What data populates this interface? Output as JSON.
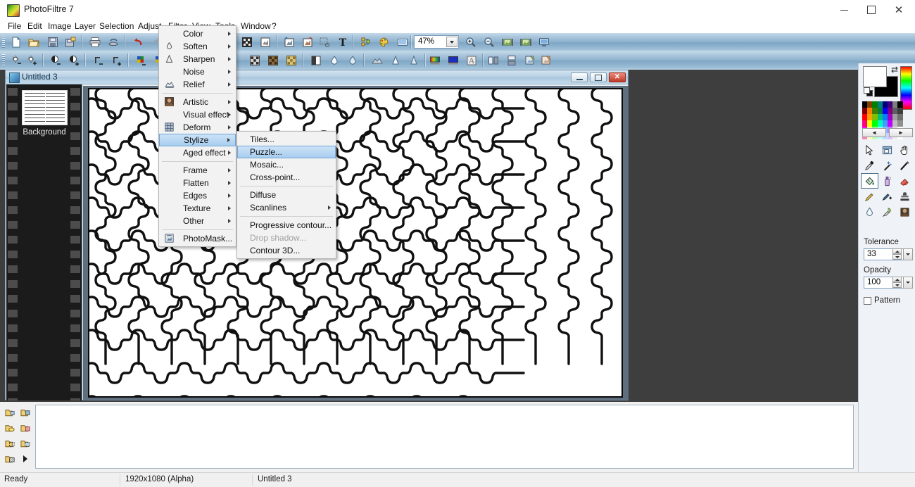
{
  "window": {
    "app_title": "PhotoFiltre 7",
    "app_icon": "photofiltre-logo-icon",
    "minimize": "minimize-icon",
    "maximize": "maximize-icon",
    "close": "close-icon"
  },
  "menubar": {
    "items": [
      {
        "label": "File",
        "accel": "F"
      },
      {
        "label": "Edit",
        "accel": "E"
      },
      {
        "label": "Image",
        "accel": "I"
      },
      {
        "label": "Layer",
        "accel": "L"
      },
      {
        "label": "Selection",
        "accel": "S"
      },
      {
        "label": "Adjust",
        "accel": "d"
      },
      {
        "label": "Filter",
        "accel": "t"
      },
      {
        "label": "View",
        "accel": "V"
      },
      {
        "label": "Tools",
        "accel": "T"
      },
      {
        "label": "Window",
        "accel": "W"
      },
      {
        "label": "?",
        "accel": ""
      }
    ],
    "active": "Filter"
  },
  "toolbar_main": {
    "zoom_value": "47%",
    "buttons": [
      "new-document-icon",
      "open-folder-icon",
      "save-icon",
      "save-as-icon",
      "print-icon",
      "print-preview-icon",
      "undo-icon",
      "redo-icon",
      "cut-icon",
      "copy-icon",
      "paste-icon",
      "image-size-icon",
      "canvas-size-icon",
      "rotate-left-icon",
      "rotate-right-icon",
      "crop-icon",
      "text-tool-icon",
      "layers-icon",
      "palette-icon",
      "slideshow-icon",
      "zoom-in-icon",
      "zoom-out-icon",
      "fit-image-icon",
      "actual-size-icon",
      "full-screen-icon"
    ]
  },
  "toolbar_filters": {
    "buttons": [
      "brightness-minus-icon",
      "brightness-plus-icon",
      "contrast-minus-icon",
      "contrast-plus-icon",
      "gamma-minus-icon",
      "gamma-plus-icon",
      "saturation-minus-icon",
      "saturation-plus-icon",
      "dither-icon",
      "halftone-icon",
      "sepia-icon",
      "grayscale-icon",
      "blur-icon",
      "soften-icon",
      "relief-icon",
      "sharpen-icon",
      "sharpen-more-icon",
      "gradient-icon",
      "color-fill-icon",
      "artistic-icon",
      "mirror-icon",
      "flip-icon",
      "photomask-icon",
      "photomask2-icon"
    ]
  },
  "filter_menu": {
    "items": [
      {
        "label": "Color",
        "submenu": true,
        "icon": null,
        "state": "normal"
      },
      {
        "label": "Soften",
        "submenu": true,
        "icon": "droplet-icon",
        "state": "normal"
      },
      {
        "label": "Sharpen",
        "submenu": true,
        "icon": "triangle-icon",
        "state": "normal"
      },
      {
        "label": "Noise",
        "submenu": true,
        "icon": null,
        "state": "normal"
      },
      {
        "label": "Relief",
        "submenu": true,
        "icon": "relief-icon",
        "state": "normal"
      },
      {
        "separator": true
      },
      {
        "label": "Artistic",
        "submenu": true,
        "icon": "portrait-icon",
        "state": "normal"
      },
      {
        "label": "Visual effect",
        "submenu": true,
        "icon": null,
        "state": "normal"
      },
      {
        "label": "Deform",
        "submenu": true,
        "icon": "grid-icon",
        "state": "normal"
      },
      {
        "label": "Stylize",
        "submenu": true,
        "icon": null,
        "state": "highlighted"
      },
      {
        "label": "Aged effect",
        "submenu": true,
        "icon": null,
        "state": "normal"
      },
      {
        "separator": true
      },
      {
        "label": "Frame",
        "submenu": true,
        "icon": null,
        "state": "normal"
      },
      {
        "label": "Flatten",
        "submenu": true,
        "icon": null,
        "state": "normal"
      },
      {
        "label": "Edges",
        "submenu": true,
        "icon": null,
        "state": "normal"
      },
      {
        "label": "Texture",
        "submenu": true,
        "icon": null,
        "state": "normal"
      },
      {
        "label": "Other",
        "submenu": true,
        "icon": null,
        "state": "normal"
      },
      {
        "separator": true
      },
      {
        "label": "PhotoMask...",
        "submenu": false,
        "icon": "photomask-icon",
        "state": "normal"
      }
    ]
  },
  "stylize_menu": {
    "items": [
      {
        "label": "Tiles...",
        "submenu": false,
        "state": "normal"
      },
      {
        "label": "Puzzle...",
        "submenu": false,
        "state": "highlighted"
      },
      {
        "label": "Mosaic...",
        "submenu": false,
        "state": "normal"
      },
      {
        "label": "Cross-point...",
        "submenu": false,
        "state": "normal"
      },
      {
        "separator": true
      },
      {
        "label": "Diffuse",
        "submenu": false,
        "state": "normal"
      },
      {
        "label": "Scanlines",
        "submenu": true,
        "state": "normal"
      },
      {
        "separator": true
      },
      {
        "label": "Progressive contour...",
        "submenu": false,
        "state": "normal"
      },
      {
        "label": "Drop shadow...",
        "submenu": false,
        "state": "disabled"
      },
      {
        "label": "Contour 3D...",
        "submenu": false,
        "state": "normal"
      }
    ]
  },
  "document": {
    "title": "Untitled 3",
    "layer_name": "Background",
    "min_btn": "minimize-icon",
    "max_btn": "restore-icon",
    "close_btn": "close-icon"
  },
  "right_panel": {
    "foreground_color": "#ffffff",
    "background_color": "#000000",
    "swap_icon": "swap-colors-icon",
    "reset_icon": "reset-colors-icon",
    "palette_prev": "◄",
    "palette_next": "►",
    "tools": [
      "pointer-select-icon",
      "rectangle-select-icon",
      "hand-pan-icon",
      "eyedropper-icon",
      "magic-wand-icon",
      "line-icon",
      "paint-bucket-icon",
      "spray-can-icon",
      "eraser-icon",
      "paintbrush-icon",
      "brush-plus-icon",
      "stamp-icon",
      "blur-drop-icon",
      "smudge-icon",
      "clone-portrait-icon"
    ],
    "selected_tool": "paint-bucket-icon",
    "tolerance_label": "Tolerance",
    "tolerance_value": "33",
    "opacity_label": "Opacity",
    "opacity_value": "100",
    "pattern_label": "Pattern",
    "pattern_checked": false
  },
  "bottom_tools": {
    "buttons": [
      "new-layer-icon",
      "duplicate-layer-icon",
      "open-layer-icon",
      "save-layer-icon",
      "layer-from-selection-icon",
      "selection-from-layer-icon",
      "transparency-layer-icon",
      "expand-arrow-icon"
    ]
  },
  "statusbar": {
    "status": "Ready",
    "dimensions": "1920x1080 (Alpha)",
    "document": "Untitled 3"
  },
  "palette_colors": [
    [
      "#000000",
      "#7f3f00",
      "#007f00",
      "#007f7f",
      "#00007f",
      "#3f007f",
      "#7f7f7f",
      "#000000"
    ],
    [
      "#7f0000",
      "#ff7f00",
      "#3f7f00",
      "#007f3f",
      "#0000ff",
      "#7f007f",
      "#5f5f5f",
      "#3f3f3f"
    ],
    [
      "#ff0000",
      "#ff9f00",
      "#7fbf00",
      "#00bf7f",
      "#007fff",
      "#9f00bf",
      "#9f9f9f",
      "#6f6f6f"
    ],
    [
      "#ff007f",
      "#ffff00",
      "#00ff00",
      "#00ffbf",
      "#3f9fff",
      "#bf00ff",
      "#bfbfbf",
      "#8f8f8f"
    ],
    [
      "#ff00ff",
      "#ffff7f",
      "#7fff7f",
      "#7fffff",
      "#7fbfff",
      "#bf7fff",
      "#dfdfdf",
      "#ffffff"
    ],
    [
      "#ff7fbf",
      "#ffffbf",
      "#bfffbf",
      "#bfffff",
      "#bfdfff",
      "#dfbfff",
      "#efefef",
      "#ffffff"
    ]
  ]
}
